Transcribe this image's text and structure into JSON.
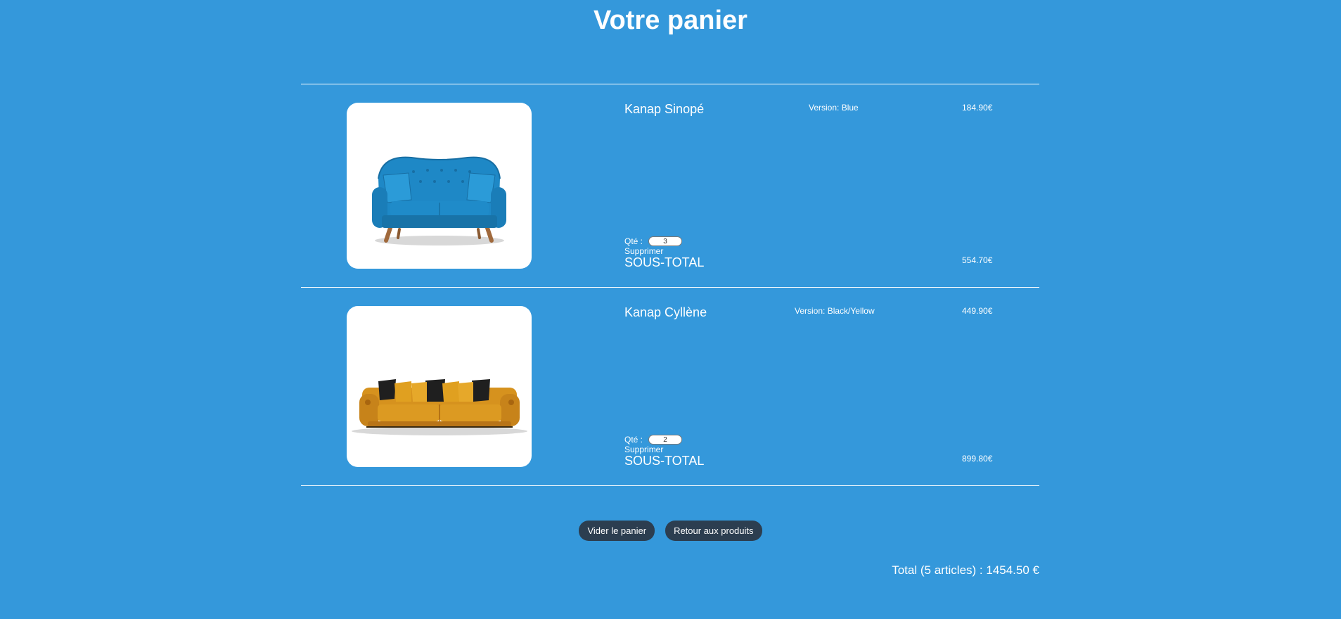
{
  "page": {
    "title": "Votre panier"
  },
  "cart": {
    "items": [
      {
        "name": "Kanap Sinopé",
        "version": "Version: Blue",
        "price": "184.90€",
        "qty_label": "Qté :",
        "qty": "3",
        "remove_label": "Supprimer",
        "subtotal_label": "SOUS-TOTAL",
        "subtotal": "554.70€",
        "image_icon": "blue-sofa-image"
      },
      {
        "name": "Kanap Cyllène",
        "version": "Version: Black/Yellow",
        "price": "449.90€",
        "qty_label": "Qté :",
        "qty": "2",
        "remove_label": "Supprimer",
        "subtotal_label": "SOUS-TOTAL",
        "subtotal": "899.80€",
        "image_icon": "yellow-sofa-image"
      }
    ]
  },
  "actions": {
    "clear_label": "Vider le panier",
    "back_label": "Retour aux produits"
  },
  "summary": {
    "total": "Total (5 articles) : 1454.50 €"
  },
  "colors": {
    "background": "#3498db",
    "button": "#2c3e50",
    "text": "#ffffff"
  }
}
